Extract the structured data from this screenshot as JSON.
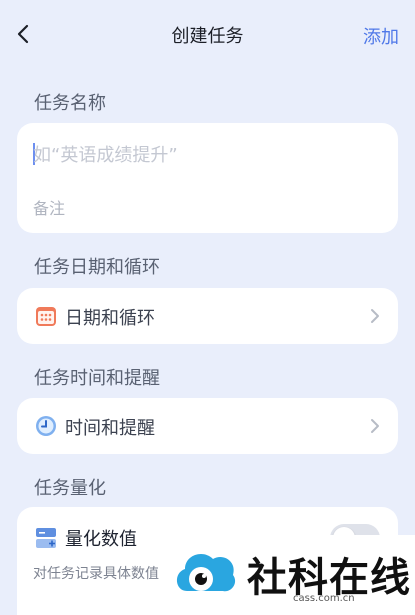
{
  "header": {
    "title": "创建任务",
    "add_label": "添加"
  },
  "name_section": {
    "label": "任务名称",
    "placeholder": "如“英语成绩提升”",
    "note_placeholder": "备注"
  },
  "date_section": {
    "label": "任务日期和循环",
    "row_text": "日期和循环"
  },
  "time_section": {
    "label": "任务时间和提醒",
    "row_text": "时间和提醒"
  },
  "quant_section": {
    "label": "任务量化",
    "title": "量化数值",
    "description": "对任务记录具体数值",
    "toggle_on": false
  },
  "watermark": {
    "text": "社科在线",
    "url": "cass.com.cn"
  },
  "colors": {
    "accent": "#4f78e8",
    "background": "#e9eefb",
    "card": "#ffffff"
  }
}
